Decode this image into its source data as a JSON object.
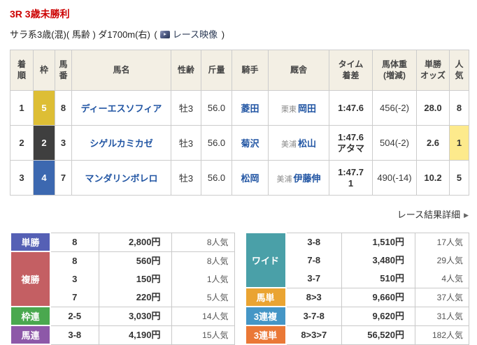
{
  "colors": {
    "title_red": "#cc0000",
    "link_blue": "#2155a3",
    "table_header_bg": "#f3efe4",
    "favorite_highlight": "#fdea8c"
  },
  "header": {
    "race_title": "3R 3歳未勝利",
    "race_conditions": "サラ系3歳(混)( 馬齢 ) ダ1700m(右)",
    "paren_open": "(",
    "video_label": "レース映像",
    "paren_close": ")"
  },
  "results_table": {
    "headers": [
      "着\n順",
      "枠",
      "馬\n番",
      "馬名",
      "性齢",
      "斤量",
      "騎手",
      "厩舎",
      "タイム\n着差",
      "馬体重\n(増減)",
      "単勝\nオッズ",
      "人\n気"
    ],
    "rows": [
      {
        "pos": "1",
        "frame": "5",
        "frame_color": "#ddbe35",
        "num": "8",
        "name": "ディーエスソフィア",
        "sex_age": "牡3",
        "weight": "56.0",
        "jockey": "菱田",
        "region": "栗東",
        "trainer": "岡田",
        "time": "1:47.6",
        "margin": "",
        "horse_weight": "456(-2)",
        "odds": "28.0",
        "popularity": "8",
        "popularity_bg": ""
      },
      {
        "pos": "2",
        "frame": "2",
        "frame_color": "#3f3f3f",
        "num": "3",
        "name": "シゲルカミカゼ",
        "sex_age": "牡3",
        "weight": "56.0",
        "jockey": "菊沢",
        "region": "美浦",
        "trainer": "松山",
        "time": "1:47.6",
        "margin": "アタマ",
        "horse_weight": "504(-2)",
        "odds": "2.6",
        "popularity": "1",
        "popularity_bg": "#fdea8c"
      },
      {
        "pos": "3",
        "frame": "4",
        "frame_color": "#3c68b0",
        "num": "7",
        "name": "マンダリンボレロ",
        "sex_age": "牡3",
        "weight": "56.0",
        "jockey": "松岡",
        "region": "美浦",
        "trainer": "伊藤伸",
        "time": "1:47.7",
        "margin": "1",
        "horse_weight": "490(-14)",
        "odds": "10.2",
        "popularity": "5",
        "popularity_bg": ""
      }
    ]
  },
  "results_link": {
    "label": "レース結果詳細",
    "arrow": "▶"
  },
  "payouts": {
    "left": {
      "sections": [
        {
          "label": "単勝",
          "color": "#5560b5",
          "combos": "8",
          "amounts": "2,800円",
          "pops": "8人気"
        },
        {
          "label": "複勝",
          "color": "#c45f63",
          "combos": [
            "8",
            "3",
            "7"
          ],
          "amounts": [
            "560円",
            "150円",
            "220円"
          ],
          "pops": [
            "8人気",
            "1人気",
            "5人気"
          ]
        },
        {
          "label": "枠連",
          "color": "#4aa84f",
          "combos": "2-5",
          "amounts": "3,030円",
          "pops": "14人気"
        },
        {
          "label": "馬連",
          "color": "#8d58a8",
          "combos": "3-8",
          "amounts": "4,190円",
          "pops": "15人気"
        }
      ]
    },
    "right": {
      "sections": [
        {
          "label": "ワイド",
          "color": "#4aa0a8",
          "combos": [
            "3-8",
            "7-8",
            "3-7"
          ],
          "amounts": [
            "1,510円",
            "3,480円",
            "510円"
          ],
          "pops": [
            "17人気",
            "29人気",
            "4人気"
          ]
        },
        {
          "label": "馬単",
          "color": "#eaa432",
          "combos": "8>3",
          "amounts": "9,660円",
          "pops": "37人気"
        },
        {
          "label": "3連複",
          "color": "#4596c6",
          "combos": "3-7-8",
          "amounts": "9,620円",
          "pops": "31人気"
        },
        {
          "label": "3連単",
          "color": "#ea7836",
          "combos": "8>3>7",
          "amounts": "56,520円",
          "pops": "182人気"
        }
      ]
    }
  }
}
